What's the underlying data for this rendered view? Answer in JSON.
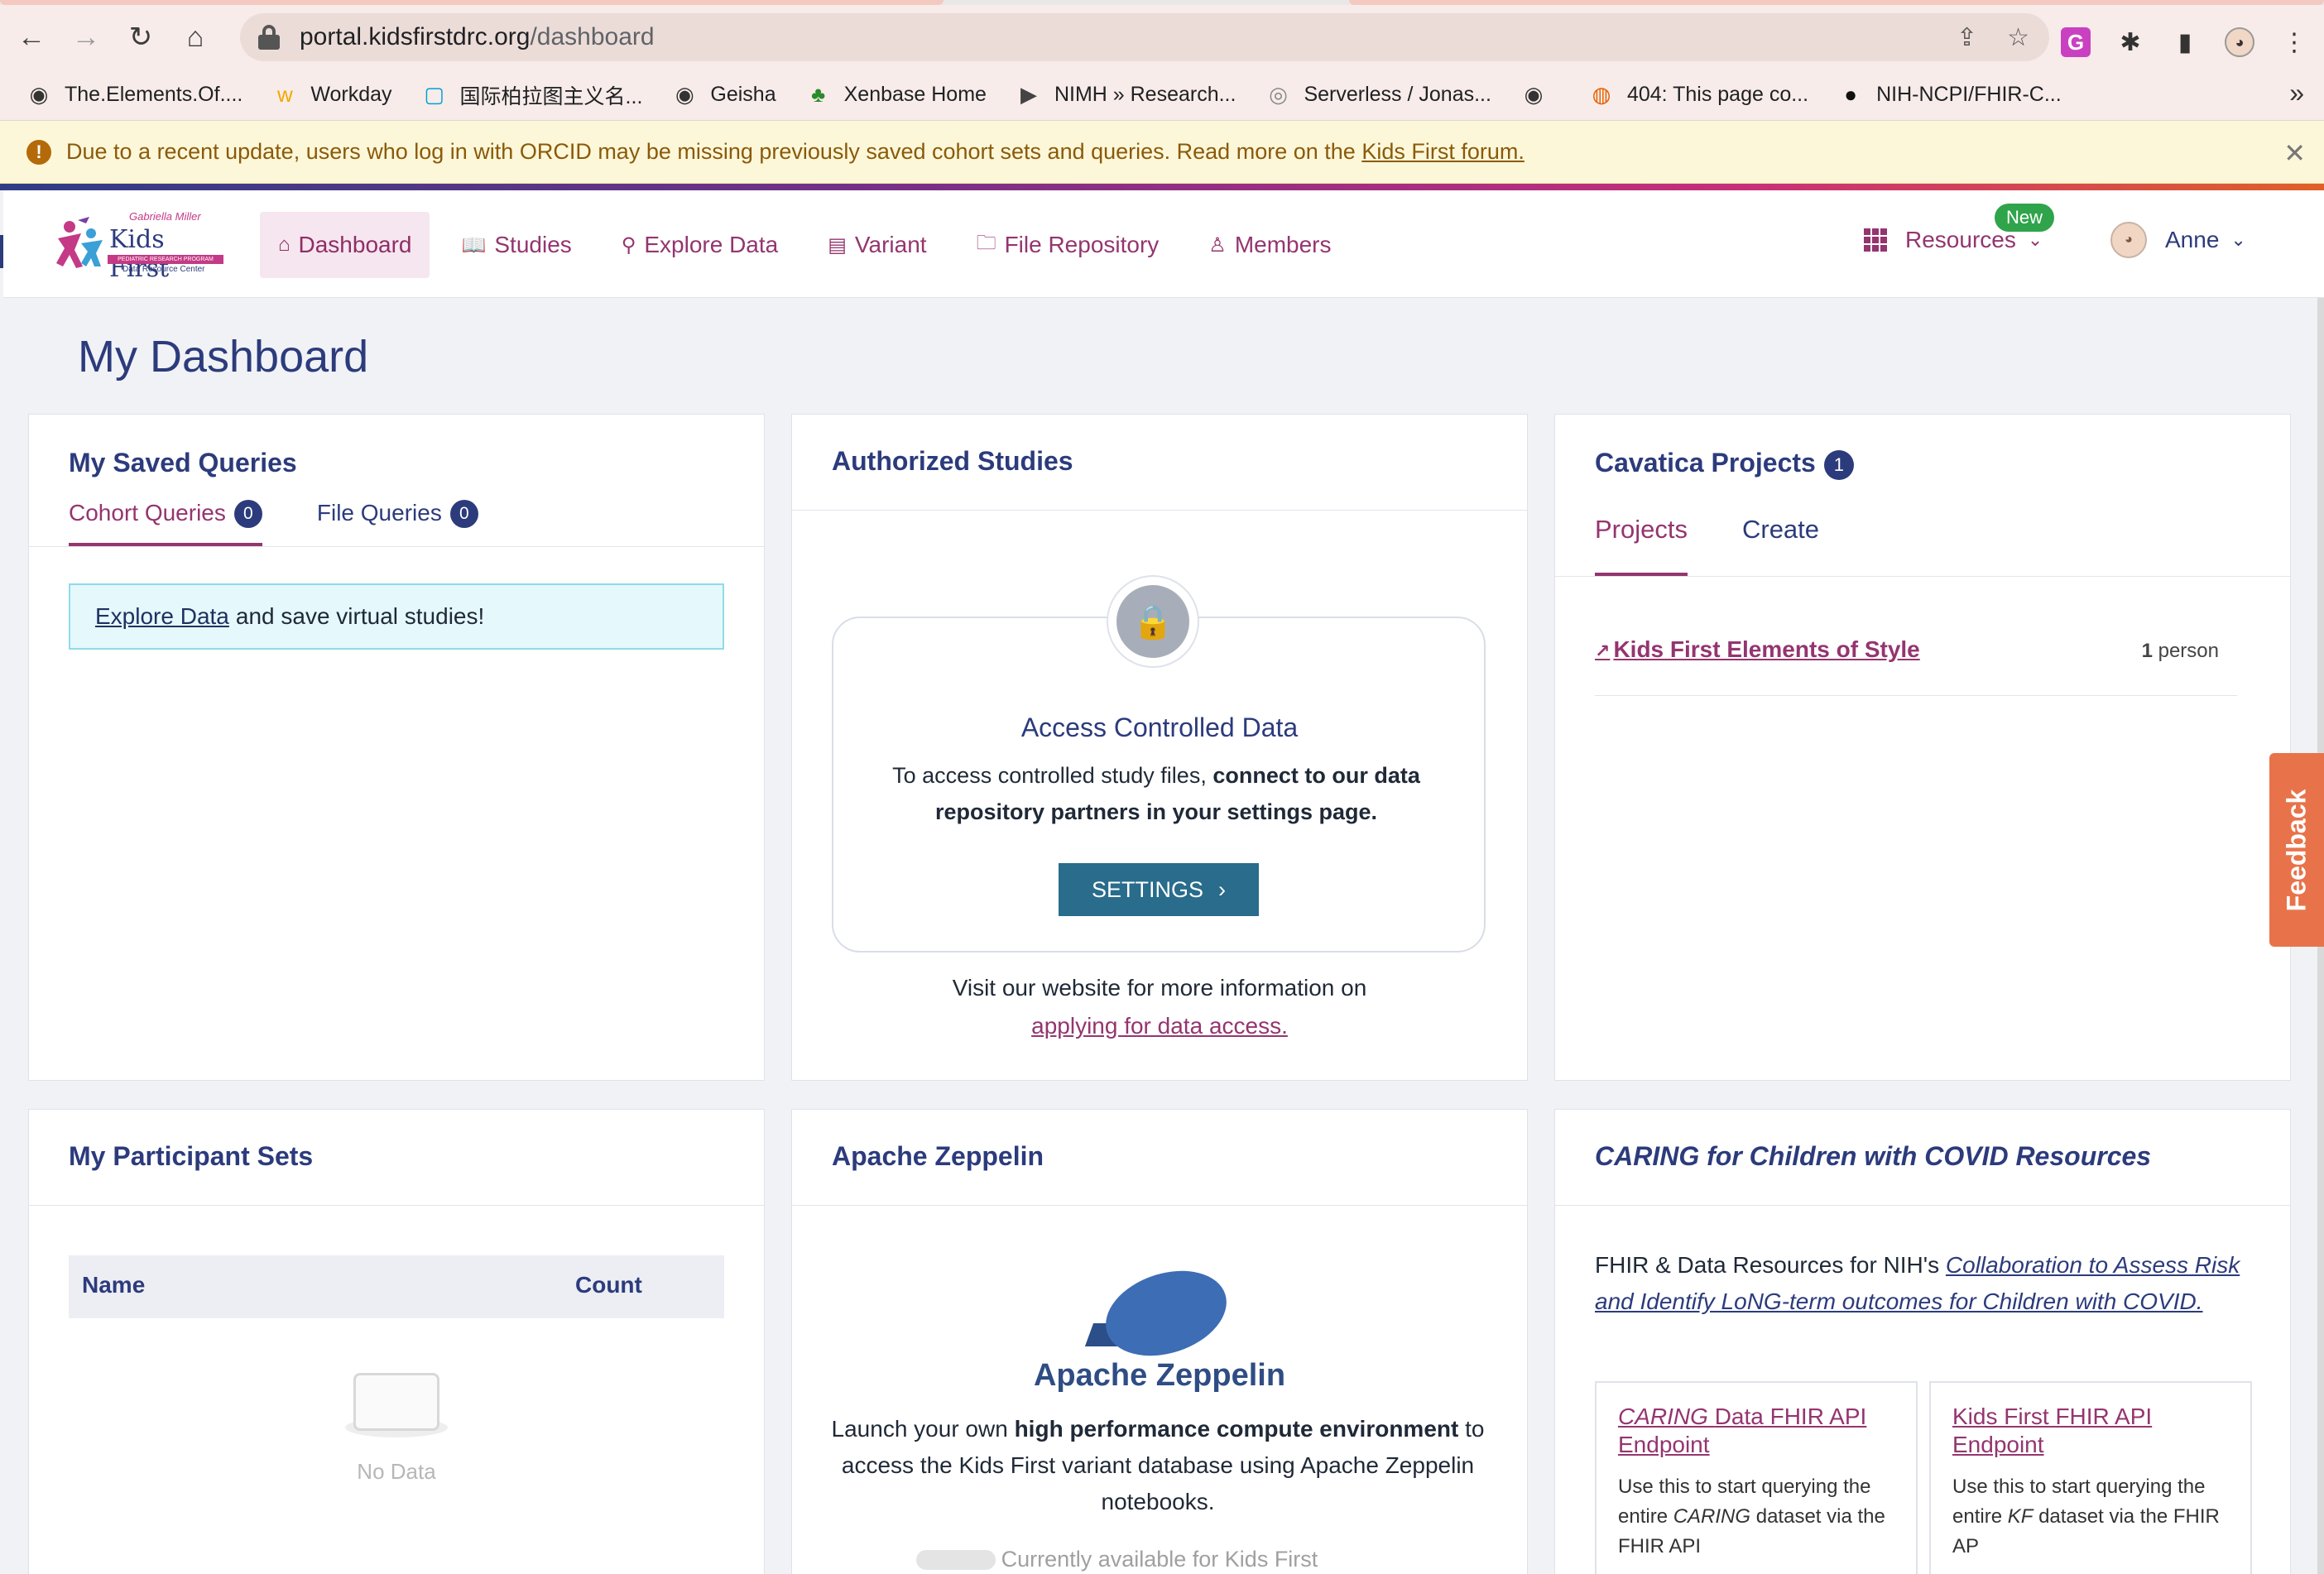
{
  "browser": {
    "url_host": "portal.kidsfirstdrc.org",
    "url_path": "/dashboard",
    "bookmarks": [
      {
        "label": "The.Elements.Of....",
        "icon": "globe-icon"
      },
      {
        "label": "Workday",
        "icon": "workday-icon"
      },
      {
        "label": "国际柏拉图主义名...",
        "icon": "bilibili-icon"
      },
      {
        "label": "Geisha",
        "icon": "globe-icon"
      },
      {
        "label": "Xenbase Home",
        "icon": "frog-icon"
      },
      {
        "label": "NIMH » Research...",
        "icon": "nimh-icon"
      },
      {
        "label": "Serverless / Jonas...",
        "icon": "serverless-icon"
      },
      {
        "label": "",
        "icon": "globe-icon"
      },
      {
        "label": "404: This page co...",
        "icon": "firefox-icon"
      },
      {
        "label": "NIH-NCPI/FHIR-C...",
        "icon": "github-icon"
      }
    ]
  },
  "banner": {
    "message": "Due to a recent update, users who log in with ORCID may be missing previously saved cohort sets and queries. Read more on the",
    "link": "Kids First forum."
  },
  "logo": {
    "line1": "Gabriella Miller",
    "name": "Kids First",
    "line2": "PEDIATRIC RESEARCH PROGRAM",
    "line3": "Data Resource Center"
  },
  "nav": {
    "items": [
      {
        "label": "Dashboard",
        "icon": "home-icon"
      },
      {
        "label": "Studies",
        "icon": "book-icon"
      },
      {
        "label": "Explore Data",
        "icon": "explore-icon"
      },
      {
        "label": "Variant",
        "icon": "variant-icon"
      },
      {
        "label": "File Repository",
        "icon": "folder-icon"
      },
      {
        "label": "Members",
        "icon": "user-icon"
      }
    ],
    "resources_label": "Resources",
    "new_badge": "New",
    "user_name": "Anne"
  },
  "page": {
    "title": "My Dashboard"
  },
  "saved_queries": {
    "title": "My Saved Queries",
    "tabs": [
      {
        "label": "Cohort Queries",
        "count": "0"
      },
      {
        "label": "File Queries",
        "count": "0"
      }
    ],
    "info_link": "Explore Data",
    "info_text": "and save virtual studies!"
  },
  "authorized_studies": {
    "title": "Authorized Studies",
    "box_title": "Access Controlled Data",
    "box_text_plain": "To access controlled study files,",
    "box_text_bold": "connect to our data repository partners in your settings page.",
    "button": "SETTINGS",
    "visit_text": "Visit our website for more information on",
    "visit_link": "applying for data access."
  },
  "cavatica": {
    "title": "Cavatica Projects",
    "count": "1",
    "tabs": [
      {
        "label": "Projects"
      },
      {
        "label": "Create"
      }
    ],
    "projects": [
      {
        "name": "Kids First Elements of Style",
        "persons_count": "1",
        "persons_label": "person"
      }
    ]
  },
  "participant_sets": {
    "title": "My Participant Sets",
    "col_name": "Name",
    "col_count": "Count",
    "empty": "No Data"
  },
  "zeppelin": {
    "title": "Apache Zeppelin",
    "logo_text": "Apache Zeppelin",
    "text_1": "Launch your own",
    "text_bold": "high performance compute environment",
    "text_2": "to access the Kids First variant database using Apache Zeppelin notebooks.",
    "availability": "Currently available for Kids First"
  },
  "caring": {
    "title": "CARING for Children with COVID Resources",
    "intro": "FHIR & Data Resources for NIH's",
    "intro_link": "Collaboration to Assess Risk and Identify LoNG-term outcomes for Children with COVID.",
    "cards": [
      {
        "title_italic": "CARING",
        "title_rest": "Data FHIR API Endpoint",
        "desc_1": "Use this to start querying the entire",
        "desc_italic": "CARING",
        "desc_2": "dataset via the FHIR API"
      },
      {
        "title_italic": "",
        "title_rest": "Kids First FHIR API Endpoint",
        "desc_1": "Use this to start querying the entire",
        "desc_italic": "KF",
        "desc_2": "dataset via the FHIR AP"
      }
    ]
  },
  "feedback_label": "Feedback",
  "colors": {
    "primary": "#2c3b7c",
    "accent": "#94356f",
    "button": "#296c8b",
    "feedback": "#e8734a",
    "banner_bg": "#fdf7d9"
  }
}
